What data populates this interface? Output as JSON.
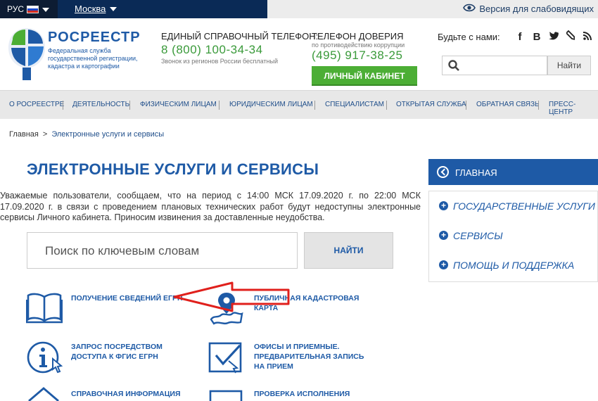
{
  "topbar": {
    "lang": "РУС",
    "city": "Москва",
    "vision": "Версия для слабовидящих"
  },
  "logo": {
    "title": "РОСРЕЕСТР",
    "sub1": "Федеральная служба",
    "sub2": "государственной регистрации,",
    "sub3": "кадастра и картографии"
  },
  "phone": {
    "title": "ЕДИНЫЙ СПРАВОЧНЫЙ ТЕЛЕФОН:",
    "number": "8 (800) 100-34-34",
    "note": "Звонок из регионов России бесплатный"
  },
  "trust": {
    "title": "ТЕЛЕФОН ДОВЕРИЯ",
    "sub": "по противодействию коррупции",
    "number": "(495) 917-38-25"
  },
  "cabinet_button": "ЛИЧНЫЙ КАБИНЕТ",
  "social": {
    "label": "Будьте с нами:",
    "icons": [
      "f",
      "В",
      "t",
      "✎",
      "rss"
    ]
  },
  "header_search": {
    "placeholder": "",
    "button": "Найти"
  },
  "nav": [
    "О Росреестре",
    "Деятельность",
    "Физическим лицам",
    "Юридическим лицам",
    "Специалистам",
    "Открытая служба",
    "Обратная связь",
    "Пресс-центр"
  ],
  "breadcrumb": {
    "home": "Главная",
    "sep": ">",
    "current": "Электронные услуги и сервисы"
  },
  "page_title": "ЭЛЕКТРОННЫЕ УСЛУГИ И СЕРВИСЫ",
  "notice": "Уважаемые пользователи, сообщаем, что на период с 14:00 МСК 17.09.2020 г. по 22:00 МСК 17.09.2020 г. в связи с проведением плановых технических работ будут недоступны электронные сервисы Личного кабинета. Приносим извинения за доставленные неудобства.",
  "main_search": {
    "placeholder": "Поиск по ключевым словам",
    "button": "НАЙТИ"
  },
  "services": {
    "egrn": "ПОЛУЧЕНИЕ СВЕДЕНИЙ ЕГРН",
    "map_line1": "ПУБЛИЧНАЯ КАДАСТРОВАЯ",
    "map_line2": "КАРТА",
    "fgis_line1": "ЗАПРОС ПОСРЕДСТВОМ",
    "fgis_line2": "ДОСТУПА К ФГИС ЕГРН",
    "offices_line1": "ОФИСЫ И ПРИЕМНЫЕ.",
    "offices_line2": "ПРЕДВАРИТЕЛЬНАЯ ЗАПИСЬ",
    "offices_line3": "НА ПРИЕМ",
    "info": "СПРАВОЧНАЯ ИНФОРМАЦИЯ",
    "check": "ПРОВЕРКА ИСПОЛНЕНИЯ"
  },
  "sidebar": {
    "head": "ГЛАВНАЯ",
    "items": [
      "ГОСУДАРСТВЕННЫЕ УСЛУГИ",
      "СЕРВИСЫ",
      "ПОМОЩЬ И ПОДДЕРЖКА"
    ]
  },
  "colors": {
    "brand_blue": "#1e5aa6",
    "navy": "#0a2a56",
    "green": "#4cae35",
    "annotation_red": "#e0201c"
  }
}
